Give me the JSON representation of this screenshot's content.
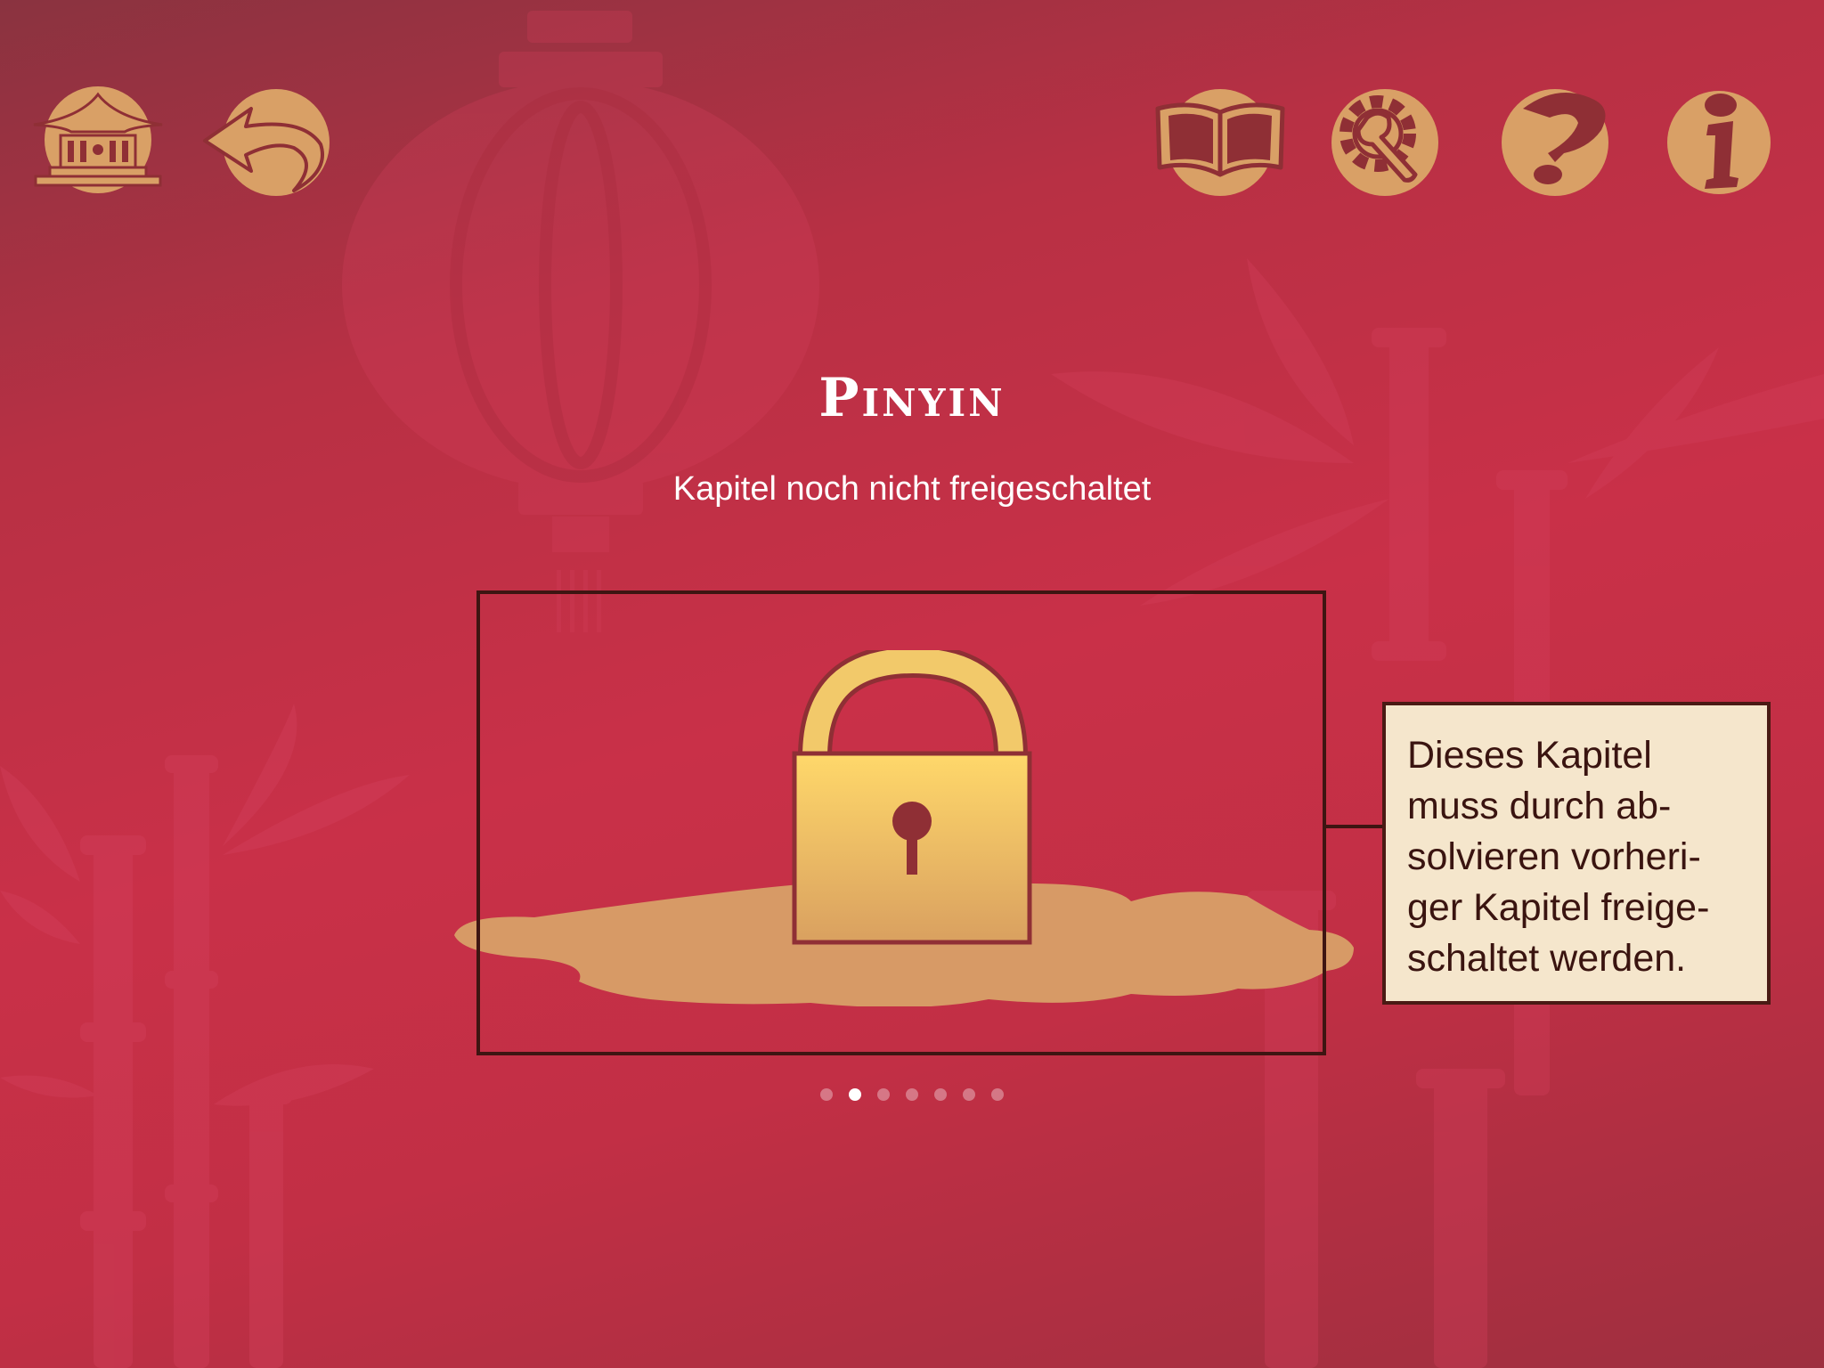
{
  "toolbar": {
    "left": [
      {
        "icon": "temple-icon",
        "label": "home"
      },
      {
        "icon": "back-arrow-icon",
        "label": "back"
      }
    ],
    "right": [
      {
        "icon": "book-icon",
        "label": "book"
      },
      {
        "icon": "settings-wrench-gear-icon",
        "label": "settings"
      },
      {
        "icon": "question-mark-icon",
        "label": "help"
      },
      {
        "icon": "info-icon",
        "label": "info"
      }
    ]
  },
  "chapter": {
    "title": "Pinyin",
    "subtitle": "Kapitel noch nicht freigeschaltet",
    "locked": true
  },
  "tooltip": {
    "lines": [
      "Dieses Kapitel",
      "muss durch ab-",
      "solvieren vorheri-",
      "ger Kapitel freige-",
      "schaltet werden."
    ]
  },
  "pagination": {
    "total": 7,
    "current": 2
  },
  "colors": {
    "background": "#c22f45",
    "icon_fill": "#d9a066",
    "icon_stroke": "#8f2f35",
    "frame": "#3e1512",
    "tooltip_bg": "#f5e6cc",
    "lock_gold": "#f2c96a"
  }
}
